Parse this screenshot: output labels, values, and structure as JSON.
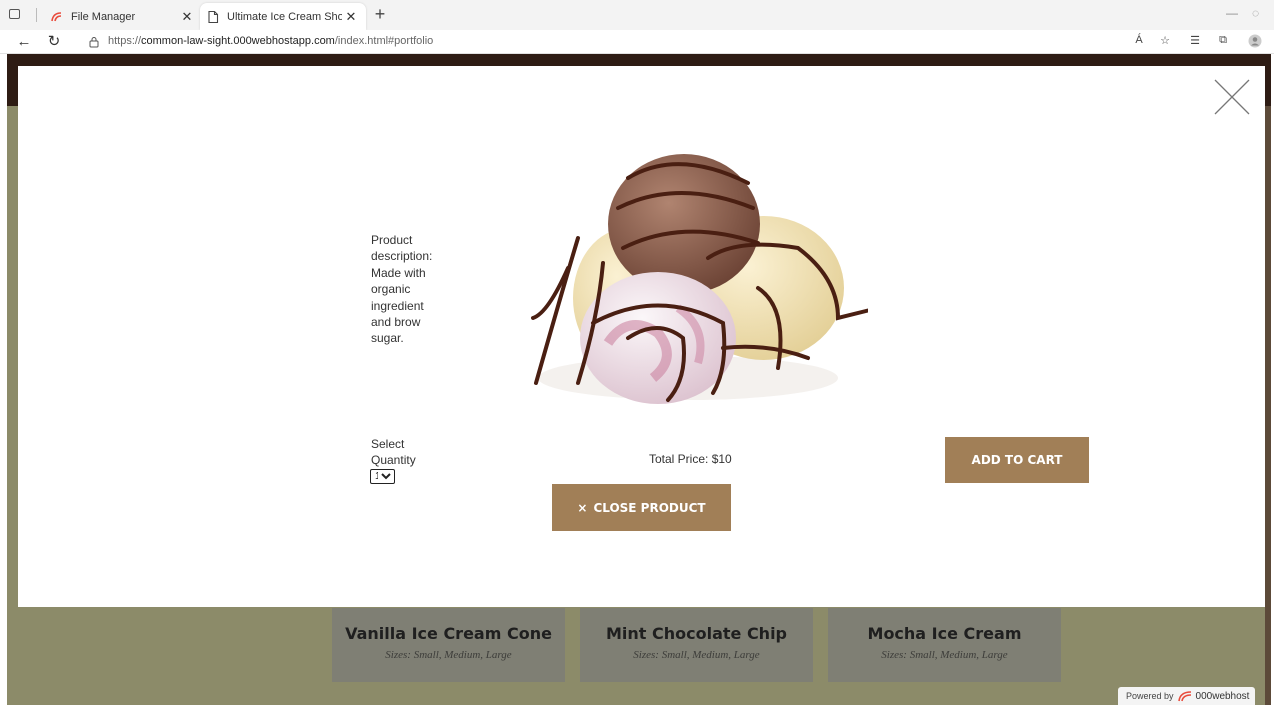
{
  "browser": {
    "tabs": [
      {
        "label": "File Manager",
        "active": false
      },
      {
        "label": "Ultimate Ice Cream Shop",
        "active": true
      }
    ],
    "url_prefix": "https://",
    "url_host": "common-law-sight.000webhostapp.com",
    "url_path": "/index.html#portfolio",
    "read_aloud_label": "Á"
  },
  "modal": {
    "description": "Product description: Made with organic ingredient and brow sugar.",
    "quantity_label": "Select Quantity",
    "quantity_selected": "1",
    "total_price": "Total Price: $10",
    "add_to_cart_label": "Add to Cart",
    "close_product_label": "Close Product",
    "close_product_glyph": "×"
  },
  "gallery": {
    "cards": [
      {
        "title": "Vanilla Ice Cream Cone",
        "subtitle": "Sizes: Small, Medium, Large"
      },
      {
        "title": "Mint Chocolate Chip",
        "subtitle": "Sizes: Small, Medium, Large"
      },
      {
        "title": "Mocha Ice Cream",
        "subtitle": "Sizes: Small, Medium, Large"
      }
    ]
  },
  "footer_badge": {
    "prefix": "Powered by",
    "brand": "000webhost"
  },
  "colors": {
    "button": "#a17f57",
    "modal_bg": "#ffffff",
    "page_header": "#2e1c14",
    "page_gallery": "#8c8b69"
  }
}
